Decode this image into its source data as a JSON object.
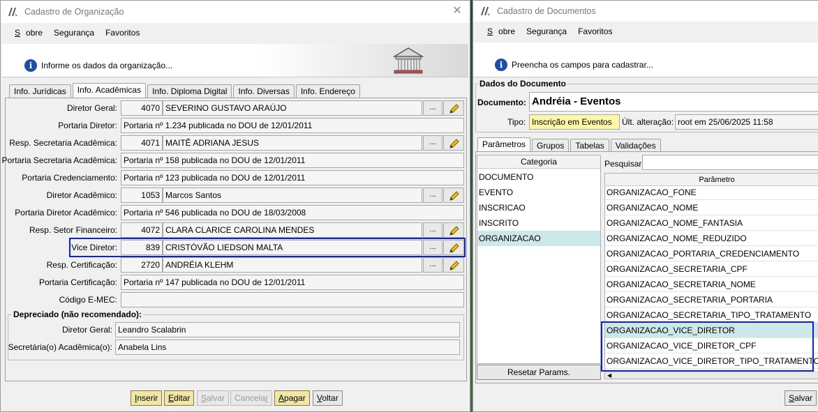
{
  "left_window": {
    "title": "Cadastro de Organização",
    "menu": [
      "Sobre",
      "Segurança",
      "Favoritos"
    ],
    "header_text": "Informe os dados da organização...",
    "tabs": [
      "Info. Jurídicas",
      "Info. Acadêmicas",
      "Info. Diploma Digital",
      "Info. Diversas",
      "Info. Endereço"
    ],
    "active_tab": "Info. Acadêmicas",
    "fields": [
      {
        "label": "Diretor Geral:",
        "code": "4070",
        "value": "SEVERINO GUSTAVO ARAÚJO",
        "lookup": true
      },
      {
        "label": "Portaria Diretor:",
        "code": "",
        "value": "Portaria nº 1.234 publicada no DOU de 12/01/2011",
        "lookup": false
      },
      {
        "label": "Resp. Secretaria Acadêmica:",
        "code": "4071",
        "value": "MAITÊ ADRIANA JESUS",
        "lookup": true
      },
      {
        "label": "Portaria Secretaria Acadêmica:",
        "code": "",
        "value": "Portaria nº 158 publicada no DOU de 12/01/2011",
        "lookup": false
      },
      {
        "label": "Portaria Credenciamento:",
        "code": "",
        "value": "Portaria nº 123 publicada no DOU de 12/01/2011",
        "lookup": false
      },
      {
        "label": "Diretor Acadêmico:",
        "code": "1053",
        "value": "Marcos Santos",
        "lookup": true
      },
      {
        "label": "Portaria Diretor Acadêmico:",
        "code": "",
        "value": "Portaria nº 546 publicada no DOU de 18/03/2008",
        "lookup": false
      },
      {
        "label": "Resp. Setor Financeiro:",
        "code": "4072",
        "value": "CLARA CLARICE CAROLINA MENDES",
        "lookup": true
      },
      {
        "label": "Vice Diretor:",
        "code": "839",
        "value": "CRISTÓVÃO LIEDSON MALTA",
        "lookup": true
      },
      {
        "label": "Resp. Certificação:",
        "code": "2720",
        "value": "ANDRÉIA KLEHM",
        "lookup": true
      },
      {
        "label": "Portaria Certificação:",
        "code": "",
        "value": "Portaria nº 147 publicada no DOU de 12/01/2011",
        "lookup": false
      },
      {
        "label": "Código E-MEC:",
        "code": "",
        "value": "",
        "lookup": false
      }
    ],
    "lookup_button_label": "...",
    "deprecated": {
      "title": "Depreciado (não recomendado):",
      "fields": [
        {
          "label": "Diretor Geral:",
          "value": "Leandro Scalabrin"
        },
        {
          "label": "Secretária(o) Acadêmica(o):",
          "value": "Anabela Lins"
        }
      ]
    },
    "buttons": {
      "inserir": "Inserir",
      "editar": "Editar",
      "salvar": "Salvar",
      "cancelar": "Cancelar",
      "apagar": "Apagar",
      "voltar": "Voltar"
    }
  },
  "right_window": {
    "title": "Cadastro de Documentos",
    "menu": [
      "Sobre",
      "Segurança",
      "Favoritos"
    ],
    "header_text": "Preencha os campos para cadastrar...",
    "section_title": "Dados do Documento",
    "documento_label": "Documento:",
    "documento_value": "Andréia - Eventos",
    "tipo_label": "Tipo:",
    "tipo_value": "Inscrição em Eventos",
    "ult_alteracao_label": "Últ. alteração:",
    "ult_alteracao_value": "root em 25/06/2025 11:58",
    "tabs": [
      "Parâmetros",
      "Grupos",
      "Tabelas",
      "Validações"
    ],
    "active_tab": "Parâmetros",
    "categoria_header": "Categoria",
    "categorias": [
      "DOCUMENTO",
      "EVENTO",
      "INSCRICAO",
      "INSCRITO",
      "ORGANIZACAO"
    ],
    "selected_categoria": "ORGANIZACAO",
    "pesquisar_label": "Pesquisar:",
    "pesquisar_value": "",
    "parametro_header": "Parâmetro",
    "parametros": [
      "ORGANIZACAO_FONE",
      "ORGANIZACAO_NOME",
      "ORGANIZACAO_NOME_FANTASIA",
      "ORGANIZACAO_NOME_REDUZIDO",
      "ORGANIZACAO_PORTARIA_CREDENCIAMENTO",
      "ORGANIZACAO_SECRETARIA_CPF",
      "ORGANIZACAO_SECRETARIA_NOME",
      "ORGANIZACAO_SECRETARIA_PORTARIA",
      "ORGANIZACAO_SECRETARIA_TIPO_TRATAMENTO",
      "ORGANIZACAO_VICE_DIRETOR",
      "ORGANIZACAO_VICE_DIRETOR_CPF",
      "ORGANIZACAO_VICE_DIRETOR_TIPO_TRATAMENTO"
    ],
    "selected_parametro": "ORGANIZACAO_VICE_DIRETOR",
    "resetar_label": "Resetar Params.",
    "salvar_label": "Salvar"
  },
  "colors": {
    "highlight_border": "#1020d0",
    "yellow_button": "#f0e6a8",
    "tipo_background": "#fff7a8",
    "selected_row": "#cce8e8"
  }
}
